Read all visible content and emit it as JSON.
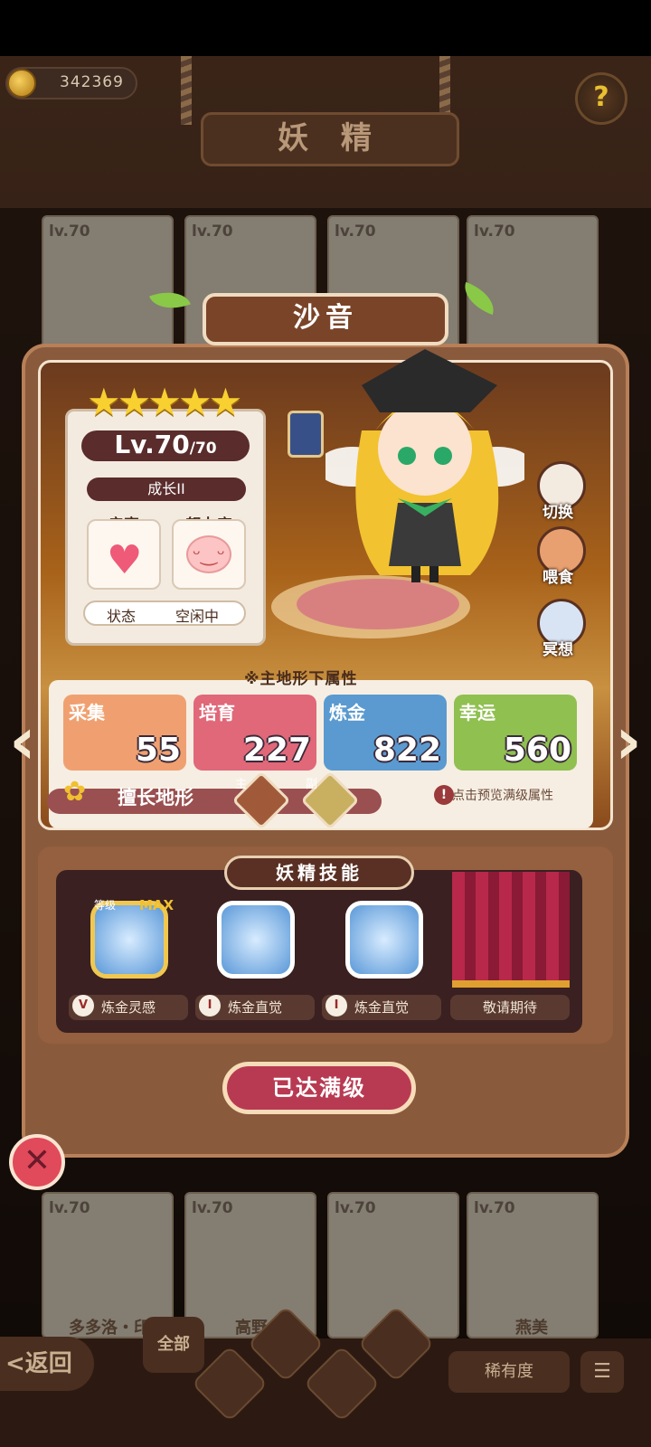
{
  "header": {
    "coins": "342369",
    "title": "妖 精",
    "help_icon": "?"
  },
  "roster": {
    "top_levels": [
      "lv.70",
      "lv.70",
      "lv.70",
      "lv.70"
    ],
    "bottom_levels": [
      "lv.70",
      "lv.70",
      "lv.70",
      "lv.70"
    ],
    "bottom_names": [
      "多多洛・印",
      "高野",
      "",
      "燕美"
    ]
  },
  "fairy": {
    "name": "沙音",
    "stars": "★★★★★",
    "level": "Lv.70",
    "level_max": "/70",
    "growth": "成长II",
    "intimacy_label": "亲密",
    "effort_label": "努力度",
    "status_label": "状态",
    "status_value": "空闲中"
  },
  "actions": {
    "switch": "切换",
    "feed": "喂食",
    "meditate": "冥想"
  },
  "attributes": {
    "header": "※主地形下属性",
    "items": [
      {
        "name": "采集",
        "value": "55",
        "color": "#f0a070"
      },
      {
        "name": "培育",
        "value": "227",
        "color": "#e06878"
      },
      {
        "name": "炼金",
        "value": "822",
        "color": "#5a9ad0"
      },
      {
        "name": "幸运",
        "value": "560",
        "color": "#90c050"
      }
    ],
    "terrain_label": "擅长地形",
    "terrain_main": "主",
    "terrain_sub": "副",
    "hint": "点击预览满级属性"
  },
  "skills": {
    "title": "妖精技能",
    "max_badge": "MAX",
    "grade_badge": "等级",
    "items": [
      {
        "rank": "V",
        "name": "炼金灵感"
      },
      {
        "rank": "I",
        "name": "炼金直觉"
      },
      {
        "rank": "I",
        "name": "炼金直觉"
      },
      {
        "rank": "",
        "name": "敬请期待"
      }
    ]
  },
  "max_level_button": "已达满级",
  "bottom_bar": {
    "back": "<返回",
    "all": "全部",
    "rarity": "稀有度",
    "menu": "☰"
  }
}
